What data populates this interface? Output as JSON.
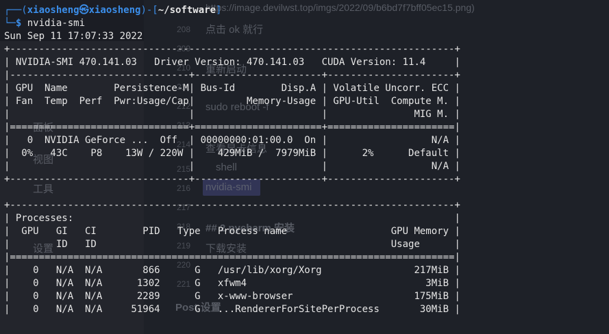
{
  "prompt": {
    "user": "xiaosheng",
    "at_glyph": "㉿",
    "host": "xiaosheng",
    "cwd": "~/software",
    "symbol": "$",
    "command": "nvidia-smi"
  },
  "output": {
    "timestamp": "Sun Sep 11 17:07:33 2022",
    "lines": [
      "+-----------------------------------------------------------------------------+",
      "| NVIDIA-SMI 470.141.03   Driver Version: 470.141.03   CUDA Version: 11.4     |",
      "|-------------------------------+----------------------+----------------------+",
      "| GPU  Name        Persistence-M| Bus-Id        Disp.A | Volatile Uncorr. ECC |",
      "| Fan  Temp  Perf  Pwr:Usage/Cap|         Memory-Usage | GPU-Util  Compute M. |",
      "|                               |                      |               MIG M. |",
      "|===============================+======================+======================|",
      "|   0  NVIDIA GeForce ...  Off  | 00000000:01:00.0  On |                  N/A |",
      "|  0%   43C    P8    13W / 220W |    429MiB /  7979MiB |      2%      Default |",
      "|                               |                      |                  N/A |",
      "+-------------------------------+----------------------+----------------------+",
      "",
      "+-----------------------------------------------------------------------------+",
      "| Processes:                                                                  |",
      "|  GPU   GI   CI        PID   Type   Process name                  GPU Memory |",
      "|        ID   ID                                                   Usage      |",
      "|=============================================================================|",
      "|    0   N/A  N/A       866      G   /usr/lib/xorg/Xorg                217MiB |",
      "|    0   N/A  N/A      1302      G   xfwm4                               3MiB |",
      "|    0   N/A  N/A      2289      G   x-www-browser                     175MiB |",
      "|    0   N/A  N/A     51964      G   ...RendererForSitePerProcess       30MiB |"
    ]
  },
  "background_window": {
    "url_text": "https://image.devilwst.top/imgs/2022/09/b6bd7f7bff05ec15.png)",
    "texts": [
      "点击 ok 就行",
      "重新启动",
      "sudo reboot -f",
      "查看显卡信息",
      "shell",
      "nvidia-smi",
      "## 2 pycharm 安装",
      "下载安装",
      "Post 设置"
    ],
    "sidebar_items": [
      "面板",
      "视图",
      "工具",
      "设置"
    ],
    "line_numbers": [
      "208",
      "209",
      "210",
      "211",
      "212",
      "213",
      "214",
      "215",
      "216",
      "217",
      "218",
      "219",
      "220",
      "221"
    ]
  },
  "colors": {
    "background": "#1b1d24",
    "prompt": "#3b8eea",
    "text": "#e6e6e6"
  }
}
